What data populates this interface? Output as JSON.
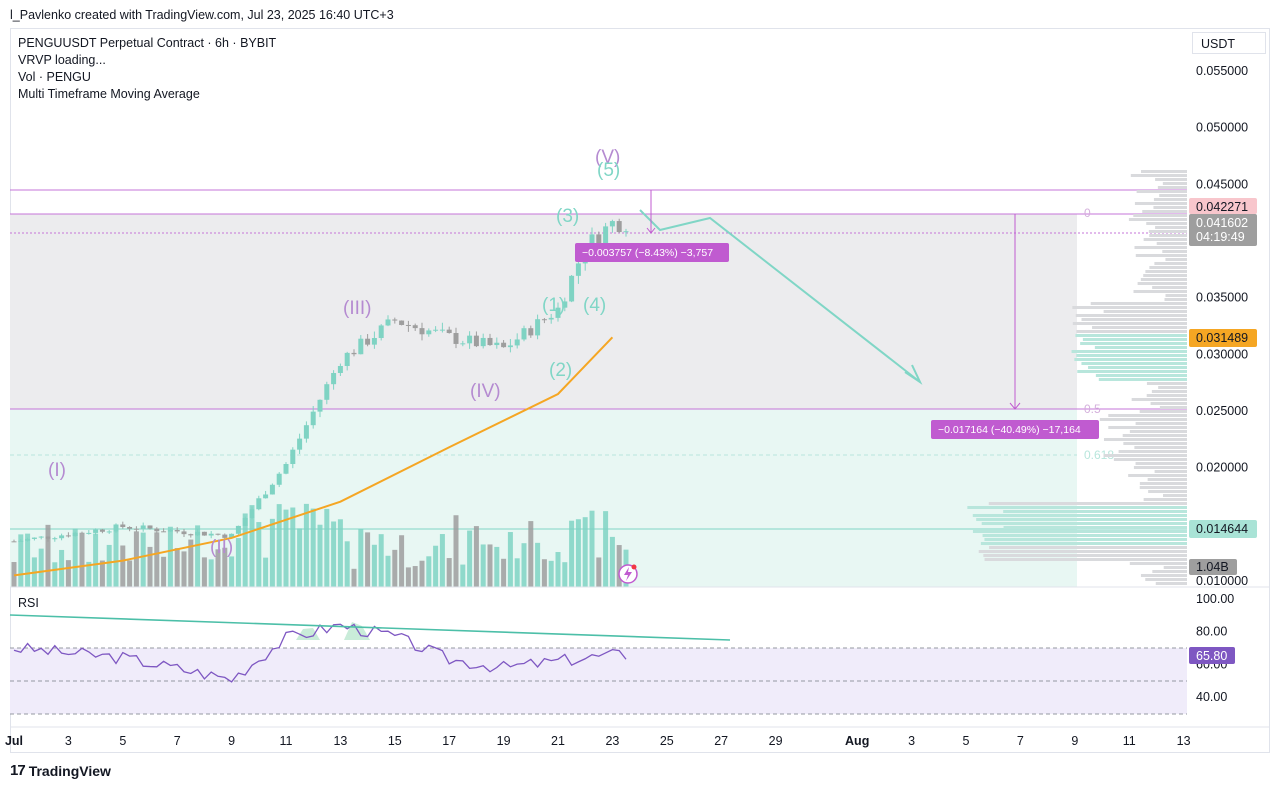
{
  "header": {
    "attribution": "l_Pavlenko created with TradingView.com, Jul 23, 2025 16:40 UTC+3"
  },
  "legend": {
    "symbol_line": "PENGUUSDT Perpetual Contract · 6h · BYBIT",
    "vrvp": "VRVP loading...",
    "vol": "Vol · PENGU",
    "ma": "Multi Timeframe Moving Average"
  },
  "currency": "USDT",
  "rsi_label": "RSI",
  "footer": {
    "brand": "TradingView"
  },
  "price_axis": {
    "ticks": [
      "0.055000",
      "0.050000",
      "0.045000",
      "0.035000",
      "0.030000",
      "0.025000",
      "0.020000",
      "0.010000"
    ]
  },
  "price_tags": {
    "high_line": "0.042271",
    "last_price": "0.041602",
    "countdown": "04:19:49",
    "ma_value": "0.031489",
    "vpoc": "0.014644",
    "volume": "1.04B"
  },
  "rsi_axis": {
    "ticks": [
      "100.00",
      "80.00",
      "60.00",
      "40.00"
    ],
    "current": "65.80"
  },
  "time_axis": {
    "ticks": [
      "Jul",
      "3",
      "5",
      "7",
      "9",
      "11",
      "13",
      "15",
      "17",
      "19",
      "21",
      "23",
      "25",
      "27",
      "29",
      "Aug",
      "3",
      "5",
      "7",
      "9",
      "11",
      "13"
    ]
  },
  "annotations": {
    "waves": [
      "(I)",
      "(II)",
      "(III)",
      "(IV)",
      "(V)",
      "(1)",
      "(2)",
      "(3)",
      "(4)",
      "(5)"
    ],
    "measure_small": "−0.003757 (−8.43%) −3,757",
    "measure_large": "−0.017164 (−40.49%) −17,164",
    "fib_levels": [
      "0",
      "0.5",
      "0.618"
    ]
  },
  "colors": {
    "bull": "#7fd3c3",
    "bear": "#9e9e9e",
    "ma": "#f5a623",
    "fib_line": "#c674d8",
    "measure": "#c05bd0",
    "arrow": "#80d6c6",
    "rsi": "#7e57c2"
  },
  "chart_data": {
    "type": "candlestick",
    "interval": "6h",
    "symbol": "PENGUUSDT",
    "price_range": [
      0.009,
      0.056
    ],
    "rsi_range": [
      30,
      100
    ],
    "candles_close_sample": [
      {
        "date": "2025-07-01",
        "close": 0.0135
      },
      {
        "date": "2025-07-05",
        "close": 0.0148
      },
      {
        "date": "2025-07-09",
        "close": 0.014
      },
      {
        "date": "2025-07-11",
        "close": 0.0203
      },
      {
        "date": "2025-07-13",
        "close": 0.0295
      },
      {
        "date": "2025-07-15",
        "close": 0.033
      },
      {
        "date": "2025-07-17",
        "close": 0.0315
      },
      {
        "date": "2025-07-19",
        "close": 0.0305
      },
      {
        "date": "2025-07-21",
        "close": 0.034
      },
      {
        "date": "2025-07-22",
        "close": 0.0395
      },
      {
        "date": "2025-07-23",
        "close": 0.0416
      }
    ],
    "moving_average": [
      {
        "date": "2025-07-01",
        "value": 0.0105
      },
      {
        "date": "2025-07-05",
        "value": 0.0118
      },
      {
        "date": "2025-07-09",
        "value": 0.0138
      },
      {
        "date": "2025-07-13",
        "value": 0.017
      },
      {
        "date": "2025-07-17",
        "value": 0.0218
      },
      {
        "date": "2025-07-21",
        "value": 0.0265
      },
      {
        "date": "2025-07-23",
        "value": 0.0315
      }
    ],
    "rsi": [
      {
        "date": "2025-07-01",
        "value": 70
      },
      {
        "date": "2025-07-05",
        "value": 64
      },
      {
        "date": "2025-07-09",
        "value": 51
      },
      {
        "date": "2025-07-11",
        "value": 76
      },
      {
        "date": "2025-07-13",
        "value": 84
      },
      {
        "date": "2025-07-15",
        "value": 77
      },
      {
        "date": "2025-07-17",
        "value": 63
      },
      {
        "date": "2025-07-19",
        "value": 58
      },
      {
        "date": "2025-07-21",
        "value": 62
      },
      {
        "date": "2025-07-23",
        "value": 65.8
      }
    ]
  }
}
